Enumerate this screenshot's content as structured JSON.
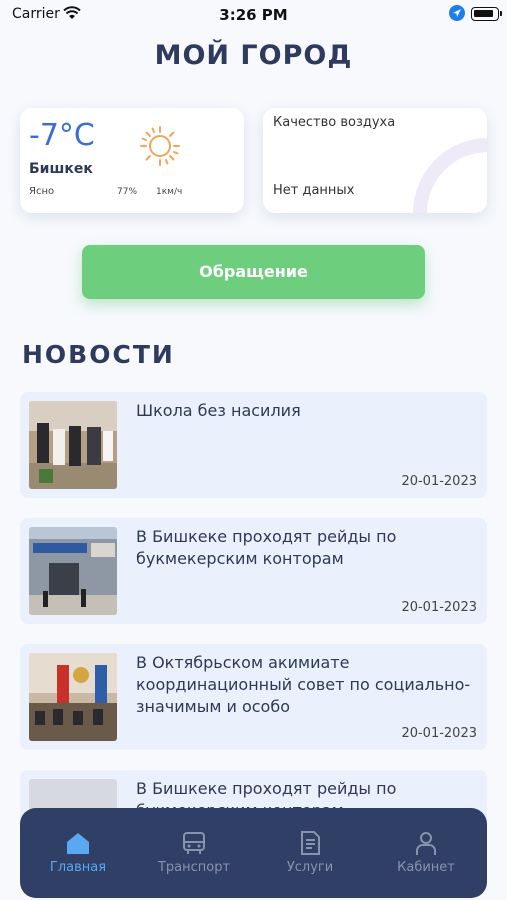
{
  "status_bar": {
    "carrier": "Carrier",
    "time": "3:26 PM"
  },
  "page_title": "МОЙ ГОРОД",
  "weather": {
    "temperature": "-7°C",
    "city": "Бишкек",
    "description": "Ясно",
    "humidity": "77%",
    "wind": "1км/ч",
    "icon": "sun-icon"
  },
  "air_quality": {
    "title": "Качество воздуха",
    "value": "Нет данных"
  },
  "appeal_button": "Обращение",
  "news": {
    "heading": "НОВОСТИ",
    "items": [
      {
        "title": "Школа без насилия",
        "date": "20-01-2023"
      },
      {
        "title": "В Бишкеке проходят рейды по букмекерским конторам",
        "date": "20-01-2023"
      },
      {
        "title": "В Октябрьском акимиате координационный совет по социально-значимым и особо",
        "date": "20-01-2023"
      },
      {
        "title": "В Бишкеке проходят рейды по букмекерским конторам",
        "date": ""
      }
    ]
  },
  "tab_bar": {
    "tabs": [
      {
        "label": "Главная",
        "icon": "home-icon",
        "active": true
      },
      {
        "label": "Транспорт",
        "icon": "bus-icon",
        "active": false
      },
      {
        "label": "Услуги",
        "icon": "document-icon",
        "active": false
      },
      {
        "label": "Кабинет",
        "icon": "user-icon",
        "active": false
      }
    ]
  },
  "colors": {
    "accent": "#6dcf7e",
    "title": "#2e3a5e",
    "tab_bar": "#2f3f66",
    "active_tab": "#5aa8f0",
    "temperature": "#3a6fd0",
    "news_bg": "#eaf0fc"
  }
}
